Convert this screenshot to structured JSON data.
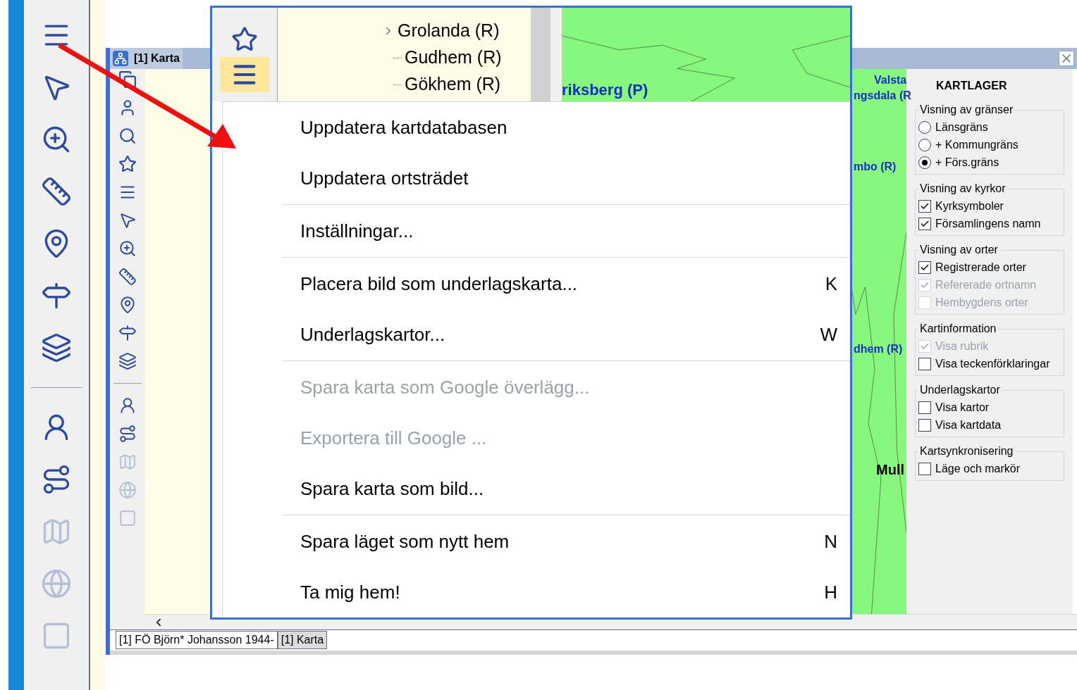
{
  "left_toolbar": [
    {
      "kind": "menu",
      "disabled": false
    },
    {
      "kind": "pointer",
      "disabled": false
    },
    {
      "kind": "zoom",
      "disabled": false
    },
    {
      "kind": "ruler",
      "disabled": false
    },
    {
      "kind": "pin",
      "disabled": false
    },
    {
      "kind": "signpost",
      "disabled": false
    },
    {
      "kind": "layers",
      "disabled": false
    },
    {
      "kind": "divider"
    },
    {
      "kind": "person",
      "disabled": false
    },
    {
      "kind": "route",
      "disabled": false
    },
    {
      "kind": "map",
      "disabled": true
    },
    {
      "kind": "globe",
      "disabled": true
    },
    {
      "kind": "square",
      "disabled": true
    }
  ],
  "window": {
    "tab_title": "[1] Karta"
  },
  "map_labels": [
    {
      "text": "Valsta"
    },
    {
      "text": "ngsdala (R"
    },
    {
      "text": "mbo (R)"
    },
    {
      "text": "dhem (R)"
    },
    {
      "text": "Mull"
    }
  ],
  "layers_panel": {
    "title": "KARTLAGER",
    "groups": [
      {
        "title": "Visning av gränser",
        "items": [
          {
            "kind": "radio",
            "label": "Länsgräns",
            "checked": false,
            "disabled": false
          },
          {
            "kind": "radio",
            "label": "+ Kommungräns",
            "checked": false,
            "disabled": false
          },
          {
            "kind": "radio",
            "label": "+ Förs.gräns",
            "checked": true,
            "disabled": false
          }
        ]
      },
      {
        "title": "Visning av kyrkor",
        "items": [
          {
            "kind": "checkbox",
            "label": "Kyrksymboler",
            "checked": true,
            "disabled": false
          },
          {
            "kind": "checkbox",
            "label": "Församlingens namn",
            "checked": true,
            "disabled": false
          }
        ]
      },
      {
        "title": "Visning av orter",
        "items": [
          {
            "kind": "checkbox",
            "label": "Registrerade orter",
            "checked": true,
            "disabled": false
          },
          {
            "kind": "checkbox",
            "label": "Refererade ortnamn",
            "checked": true,
            "disabled": true
          },
          {
            "kind": "checkbox",
            "label": "Hembygdens orter",
            "checked": false,
            "disabled": true
          }
        ]
      },
      {
        "title": "Kartinformation",
        "items": [
          {
            "kind": "checkbox",
            "label": "Visa rubrik",
            "checked": true,
            "disabled": true
          },
          {
            "kind": "checkbox",
            "label": "Visa teckenförklaringar",
            "checked": false,
            "disabled": false
          }
        ]
      },
      {
        "title": "Underlagskartor",
        "items": [
          {
            "kind": "checkbox",
            "label": "Visa kartor",
            "checked": false,
            "disabled": false
          },
          {
            "kind": "checkbox",
            "label": "Visa kartdata",
            "checked": false,
            "disabled": false
          }
        ]
      },
      {
        "title": "Kartsynkronisering",
        "items": [
          {
            "kind": "checkbox",
            "label": "Läge och markör",
            "checked": false,
            "disabled": false
          }
        ]
      }
    ]
  },
  "bottom_tabs": [
    {
      "label": "[1] FÖ Björn* Johansson 1944-",
      "selected": false
    },
    {
      "label": "[1] Karta",
      "selected": true
    }
  ],
  "callout": {
    "tree_items": [
      {
        "label": "Grolanda (R)",
        "expandable": true
      },
      {
        "label": "Gudhem (R)",
        "expandable": false
      },
      {
        "label": "Gökhem (R)",
        "expandable": false
      }
    ],
    "map_label": "riksberg (P)",
    "menu": [
      {
        "kind": "item",
        "label": "Uppdatera kartdatabasen",
        "disabled": false
      },
      {
        "kind": "item",
        "label": "Uppdatera ortsträdet",
        "disabled": false
      },
      {
        "kind": "separator"
      },
      {
        "kind": "item",
        "label": "Inställningar...",
        "disabled": false
      },
      {
        "kind": "separator"
      },
      {
        "kind": "item",
        "label": "Placera bild som underlagskarta...",
        "shortcut": "K",
        "disabled": false
      },
      {
        "kind": "item",
        "label": "Underlagskartor...",
        "shortcut": "W",
        "disabled": false
      },
      {
        "kind": "separator"
      },
      {
        "kind": "item",
        "label": "Spara karta som Google överlägg...",
        "disabled": true
      },
      {
        "kind": "item",
        "label": "Exportera till Google ...",
        "disabled": true
      },
      {
        "kind": "item",
        "label": "Spara karta som bild...",
        "disabled": false
      },
      {
        "kind": "separator"
      },
      {
        "kind": "item",
        "label": "Spara läget som nytt hem",
        "shortcut": "N",
        "disabled": false
      },
      {
        "kind": "item",
        "label": "Ta mig hem!",
        "shortcut": "H",
        "disabled": false
      }
    ]
  }
}
